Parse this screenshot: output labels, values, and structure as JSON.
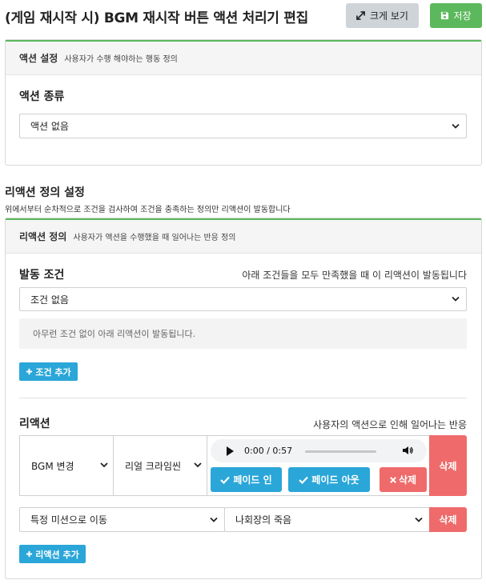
{
  "header": {
    "title": "(게임 재시작 시) BGM 재시작 버튼 액션 처리기 편집",
    "expand_label": "크게 보기",
    "save_label": "저장"
  },
  "action_settings": {
    "title": "액션 설정",
    "subtitle": "사용자가 수행 해야하는 행동 정의",
    "type_label": "액션 종류",
    "type_value": "액션 없음"
  },
  "reaction_settings": {
    "title": "리액션 정의 설정",
    "subtitle": "위에서부터 순차적으로 조건을 검사하여 조건을 충족하는 정의만 리액션이 발동합니다"
  },
  "reaction_definition": {
    "title": "리액션 정의",
    "subtitle": "사용자가 액션을 수행했을 때 일어나는 반응 정의",
    "trigger_label": "발동 조건",
    "trigger_hint": "아래 조건들을 모두 만족했을 때 이 리액션이 발동됩니다",
    "condition_value": "조건 없음",
    "empty_message": "아무런 조건 없이 아래 리액션이 발동됩니다.",
    "add_condition_label": "조건 추가",
    "reactions_label": "리액션",
    "reactions_hint": "사용자의 액션으로 인해 일어나는 반응",
    "reaction1": {
      "type": "BGM 변경",
      "track": "리얼 크라임씬",
      "audio_time": "0:00 / 0:57",
      "audio_progress": 0.0,
      "fade_in_label": "페이드 인",
      "fade_out_label": "페이드 아웃",
      "inner_delete_label": "삭제",
      "delete_label": "삭제"
    },
    "reaction2": {
      "type": "특정 미션으로 이동",
      "target": "나회장의 죽음",
      "delete_label": "삭제"
    },
    "add_reaction_label": "리액션 추가"
  },
  "colors": {
    "save": "#5cb85c",
    "primary": "#2aa6d8",
    "danger": "#ef6b6b",
    "neutral": "#cfd4d9"
  }
}
